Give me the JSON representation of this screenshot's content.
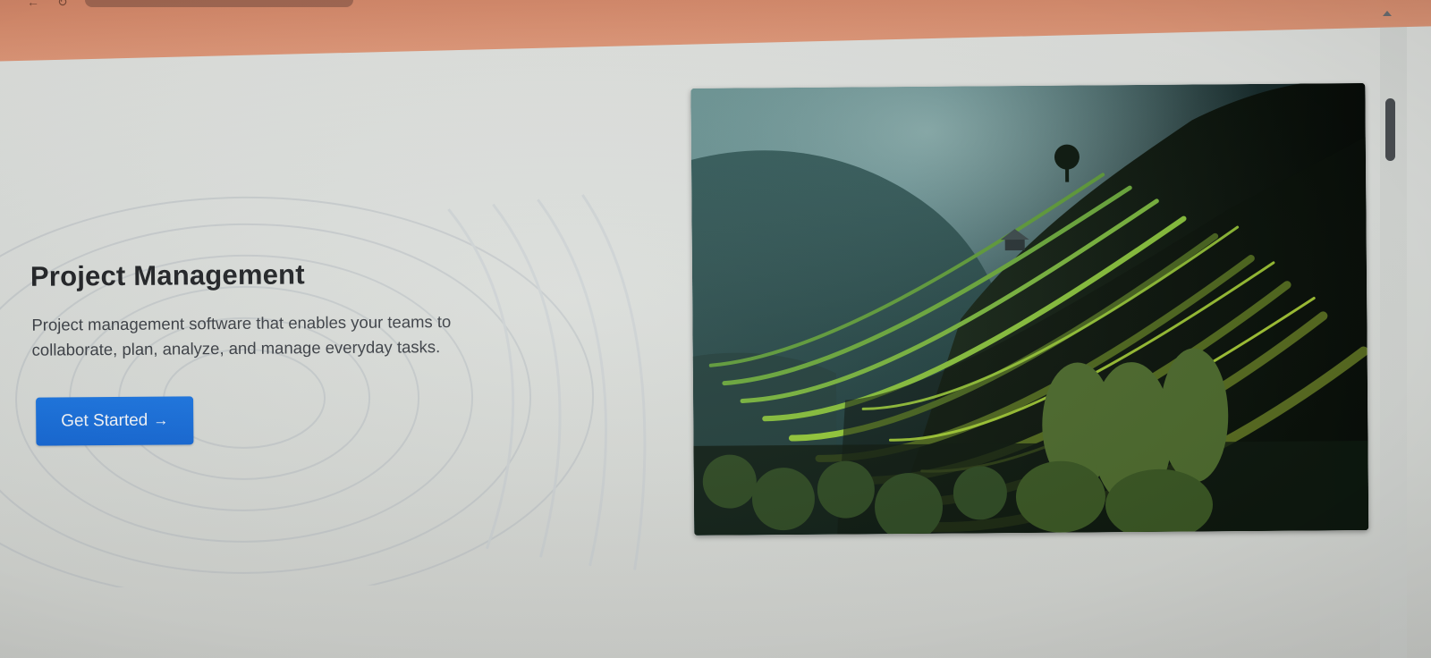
{
  "hero": {
    "title": "Project Management",
    "description": "Project management software that enables your teams to collaborate, plan, analyze, and manage everyday tasks.",
    "cta_label": "Get Started",
    "cta_arrow": "→",
    "image": "rice-terraces-photo"
  },
  "colors": {
    "accent": "#1a70dc",
    "browser_chrome": "#d88c6d",
    "page_background": "#dcdfdc"
  },
  "icons": {
    "cta_arrow": "arrow-right-icon",
    "scroll_up": "scroll-up-icon"
  }
}
